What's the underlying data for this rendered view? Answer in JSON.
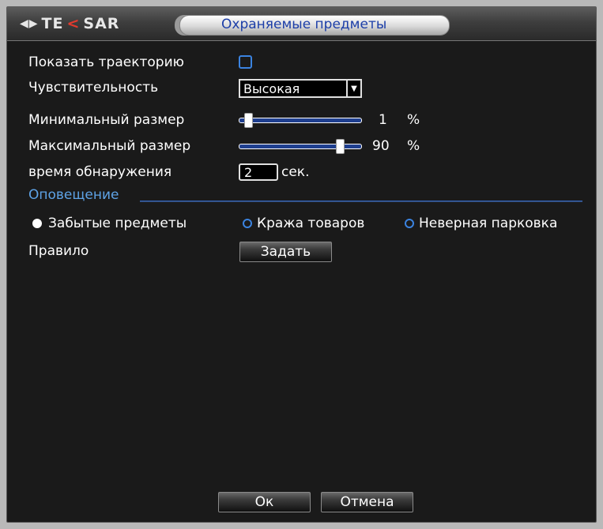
{
  "window": {
    "brand": {
      "part1": "TE",
      "part2": "<",
      "part3": "SAR"
    },
    "title": "Охраняемые предметы"
  },
  "form": {
    "show_trajectory_label": "Показать траекторию",
    "show_trajectory_checked": false,
    "sensitivity_label": "Чувствительность",
    "sensitivity_value": "Высокая",
    "min_size_label": "Минимальный размер",
    "min_size_value": "1",
    "min_size_unit": "%",
    "min_size_percent": 1,
    "max_size_label": "Максимальный размер",
    "max_size_value": "90",
    "max_size_unit": "%",
    "max_size_percent": 90,
    "detect_time_label": "время обнаружения",
    "detect_time_value": "2",
    "detect_time_unit": "сек.",
    "notify_section": "Оповещение",
    "modes": [
      {
        "label": "Забытые предметы",
        "selected": true
      },
      {
        "label": "Кража товаров",
        "selected": false
      },
      {
        "label": "Неверная парковка",
        "selected": false
      }
    ],
    "rule_label": "Правило",
    "rule_button": "Задать"
  },
  "footer": {
    "ok_label": "Ок",
    "cancel_label": "Отмена"
  },
  "colors": {
    "accent_blue": "#3b83e0",
    "section_blue": "#5ea3e6",
    "title_blue": "#1c3ea8",
    "logo_red": "#e23a2e"
  }
}
